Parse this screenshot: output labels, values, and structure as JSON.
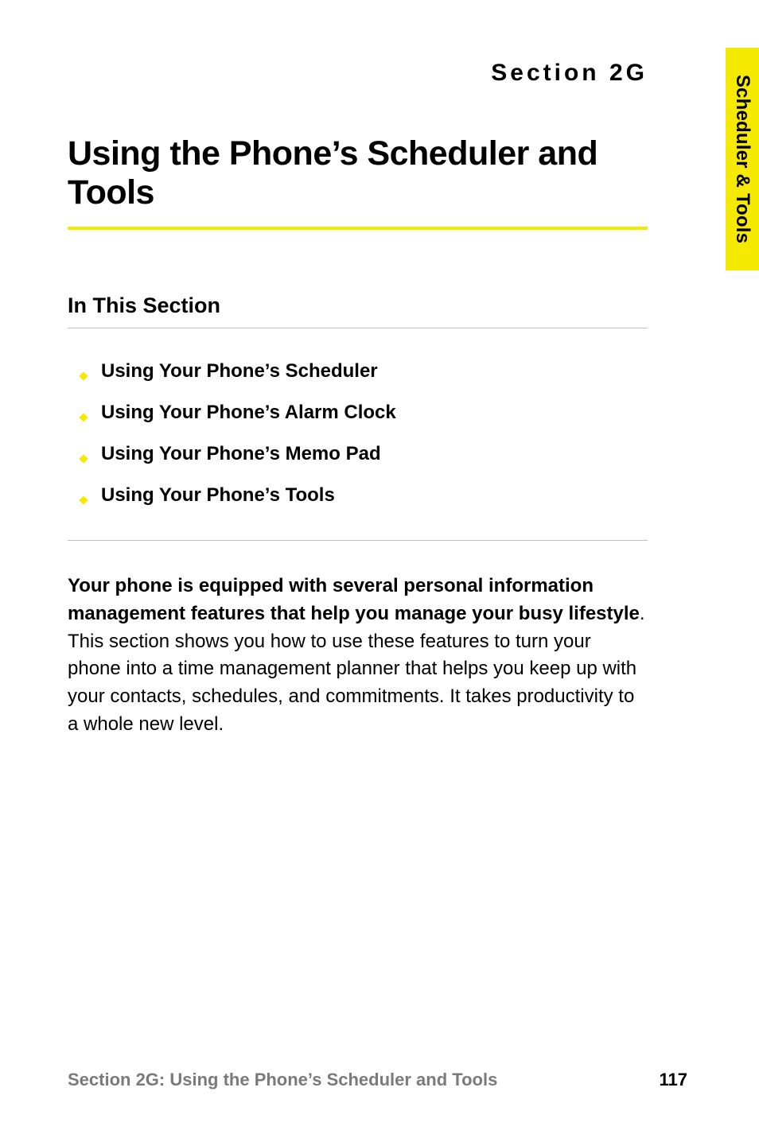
{
  "tab": {
    "label": "Scheduler & Tools"
  },
  "section_label": "Section 2G",
  "title": "Using the Phone’s Scheduler and Tools",
  "subhead": "In This Section",
  "toc": [
    {
      "label": "Using Your Phone’s Scheduler"
    },
    {
      "label": "Using Your Phone’s Alarm Clock"
    },
    {
      "label": "Using Your Phone’s Memo Pad"
    },
    {
      "label": "Using Your Phone’s Tools"
    }
  ],
  "lead": "Your phone is equipped with several personal information management features that help you manage your busy lifestyle",
  "lead_suffix": ". ",
  "body": "This section shows you how to use these features to turn your phone into a time management planner that helps you keep up with your contacts, schedules, and commitments. It takes productivity to a whole new level.",
  "footer": {
    "left": "Section 2G: Using the Phone’s Scheduler and Tools",
    "page": "117"
  },
  "colors": {
    "accent": "#f6e900",
    "rule": "#bfbfbf",
    "muted": "#7a7a7a"
  }
}
